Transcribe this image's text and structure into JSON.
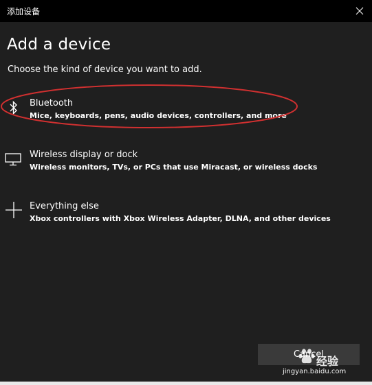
{
  "window": {
    "title": "添加设备"
  },
  "main": {
    "heading": "Add a device",
    "subheading": "Choose the kind of device you want to add."
  },
  "options": [
    {
      "icon": "bluetooth-icon",
      "label": "Bluetooth",
      "description": "Mice, keyboards, pens, audio devices, controllers, and more"
    },
    {
      "icon": "monitor-icon",
      "label": "Wireless display or dock",
      "description": "Wireless monitors, TVs, or PCs that use Miracast, or wireless docks"
    },
    {
      "icon": "plus-icon",
      "label": "Everything else",
      "description": "Xbox controllers with Xbox Wireless Adapter, DLNA, and other devices"
    }
  ],
  "footer": {
    "cancel_label": "Cancel"
  },
  "watermark": {
    "brand": "经验",
    "url": "jingyan.baidu.com"
  },
  "colors": {
    "background": "#1f1f1f",
    "titlebar": "#000000",
    "highlight_ring": "#d03030",
    "button": "#3a3a3a"
  }
}
